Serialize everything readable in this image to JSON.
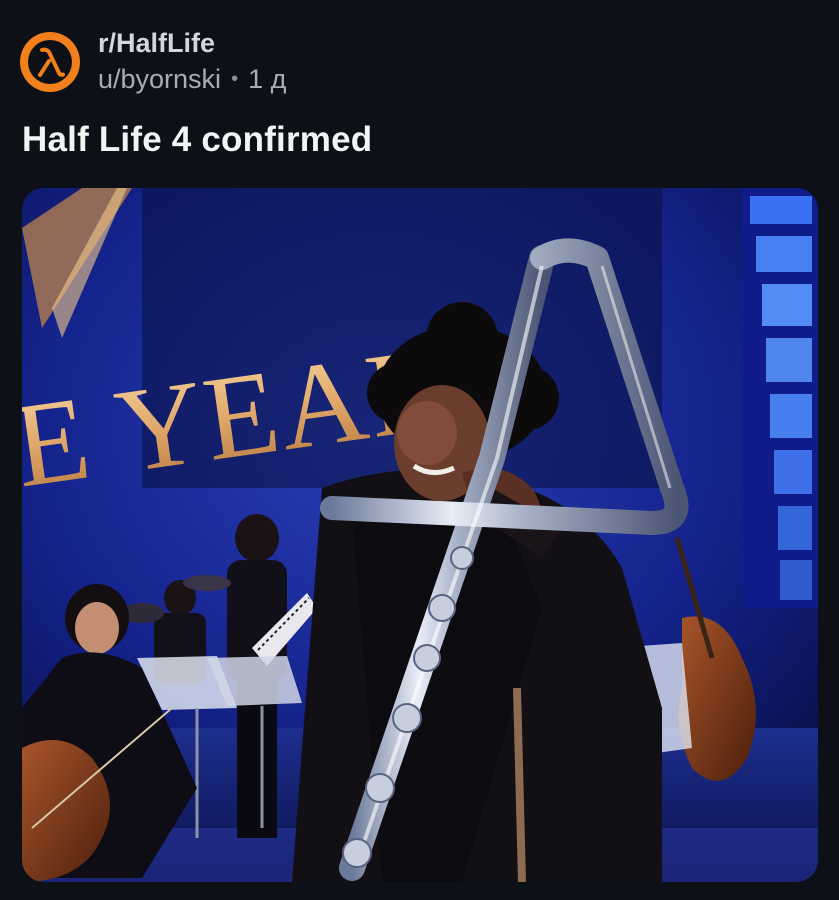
{
  "post": {
    "subreddit": "r/HalfLife",
    "author": "u/byornski",
    "separator": "•",
    "age": "1 д",
    "title": "Half Life 4 confirmed",
    "image_text": "E YEAR"
  },
  "colors": {
    "background": "#0d1117",
    "avatar": "#f07f1c",
    "title": "#f2f3f5",
    "meta": "#a9adb3"
  },
  "icons": {
    "avatar": "half-life-lambda-icon"
  }
}
